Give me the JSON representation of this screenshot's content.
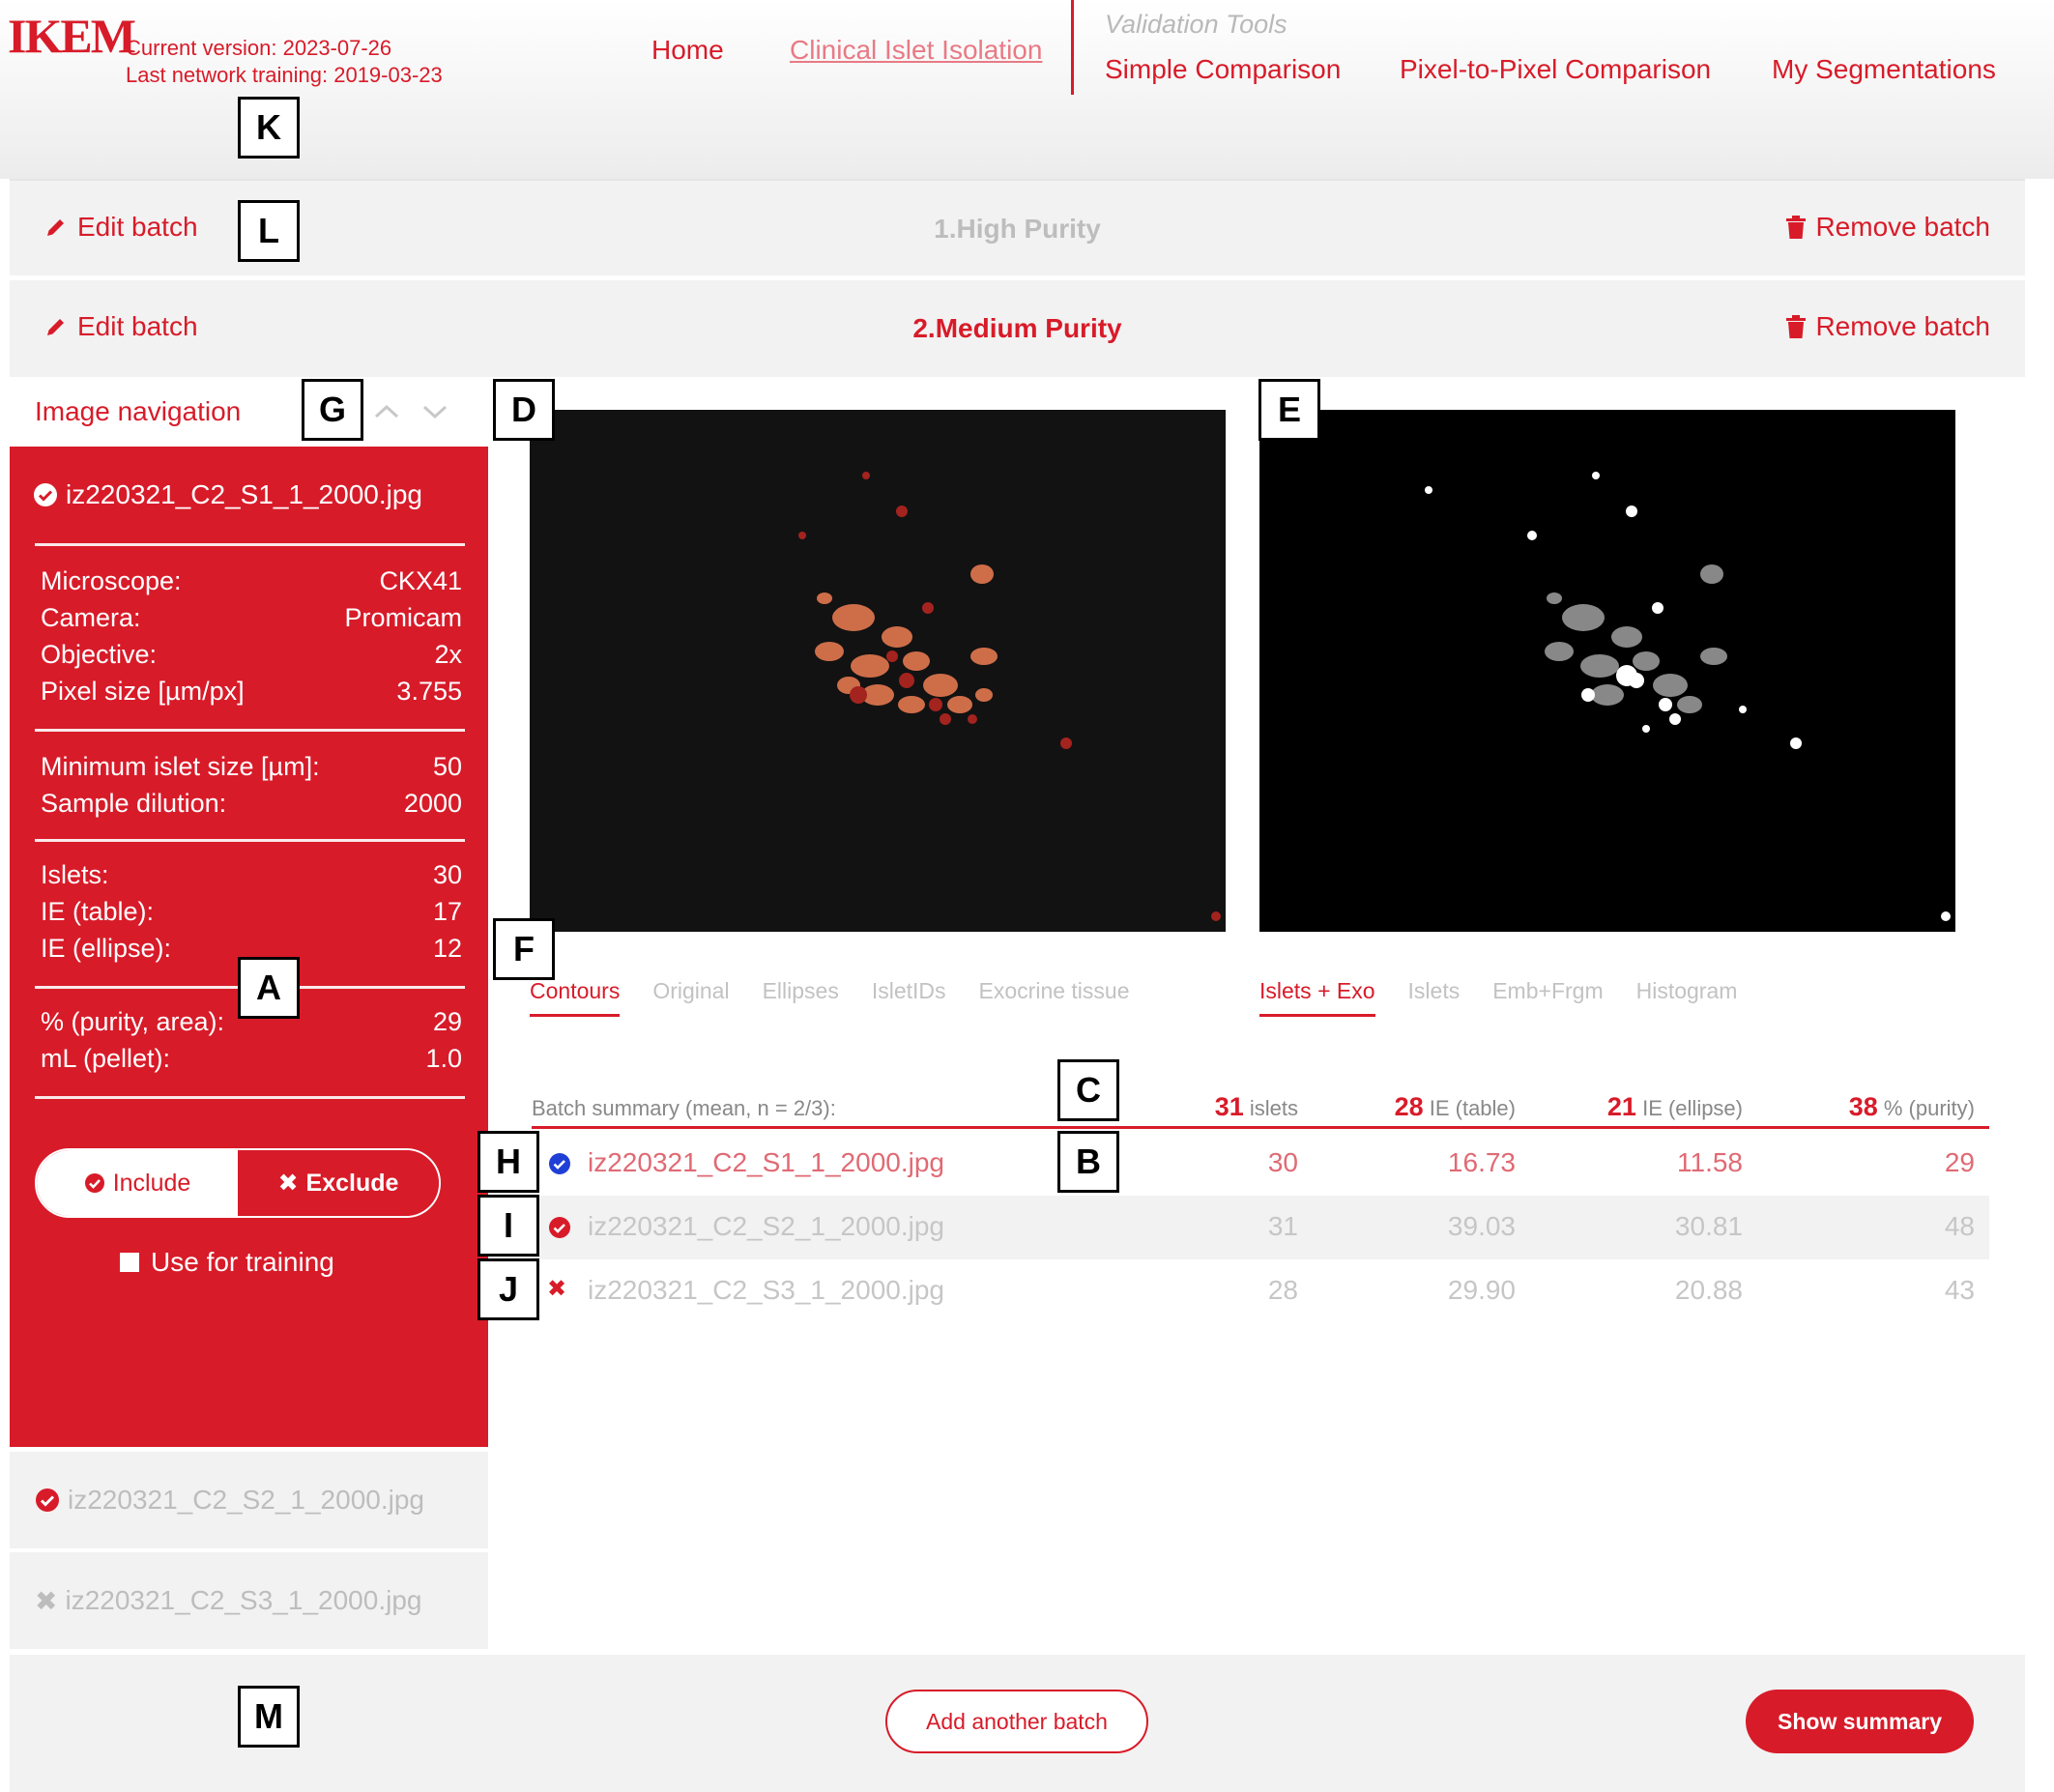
{
  "header": {
    "logo_line1": "IKEM",
    "logo_line2": "M",
    "current_version": "Current version: 2023-07-26",
    "last_training": "Last network training: 2019-03-23",
    "nav": {
      "home": "Home",
      "clinical": "Clinical Islet Isolation",
      "group_label": "Validation Tools",
      "simple": "Simple Comparison",
      "pixel": "Pixel-to-Pixel Comparison",
      "my_segmentations": "My Segmentations"
    }
  },
  "batches": [
    {
      "title": "1.High Purity",
      "edit_label": "Edit batch",
      "remove_label": "Remove batch"
    },
    {
      "title": "2.Medium Purity",
      "edit_label": "Edit batch",
      "remove_label": "Remove batch"
    }
  ],
  "sidebar": {
    "nav_label": "Image navigation",
    "selected_file": "iz220321_C2_S1_1_2000.jpg",
    "microscope_label": "Microscope:",
    "microscope": "CKX41",
    "camera_label": "Camera:",
    "camera": "Promicam",
    "objective_label": "Objective:",
    "objective": "2x",
    "pixel_label": "Pixel size [µm/px]",
    "pixel_size": "3.755",
    "min_islet_label": "Minimum islet size [µm]:",
    "min_islet": "50",
    "dilution_label": "Sample dilution:",
    "dilution": "2000",
    "islets_label": "Islets:",
    "islets": "30",
    "ie_table_label": "IE (table):",
    "ie_table": "17",
    "ie_ellipse_label": "IE (ellipse):",
    "ie_ellipse": "12",
    "purity_label": "% (purity, area):",
    "purity": "29",
    "pellet_label": "mL (pellet):",
    "pellet": "1.0",
    "include_label": "Include",
    "exclude_label": "Exclude",
    "training_label": "Use for training",
    "other_files": [
      "iz220321_C2_S2_1_2000.jpg",
      "iz220321_C2_S3_1_2000.jpg"
    ]
  },
  "tabs_left": [
    "Contours",
    "Original",
    "Ellipses",
    "IsletIDs",
    "Exocrine tissue"
  ],
  "tabs_right": [
    "Islets + Exo",
    "Islets",
    "Emb+Frgm",
    "Histogram"
  ],
  "summary": {
    "label": "Batch summary (mean, n = 2/3):",
    "islets_val": "31",
    "islets_unit": "islets",
    "ie_table_val": "28",
    "ie_table_unit": "IE (table)",
    "ie_ellipse_val": "21",
    "ie_ellipse_unit": "IE (ellipse)",
    "purity_val": "38",
    "purity_unit": "% (purity)",
    "rows": [
      {
        "file": "iz220321_C2_S1_1_2000.jpg",
        "islets": "30",
        "ie_table": "16.73",
        "ie_ellipse": "11.58",
        "purity": "29",
        "status": "current"
      },
      {
        "file": "iz220321_C2_S2_1_2000.jpg",
        "islets": "31",
        "ie_table": "39.03",
        "ie_ellipse": "30.81",
        "purity": "48",
        "status": "included"
      },
      {
        "file": "iz220321_C2_S3_1_2000.jpg",
        "islets": "28",
        "ie_table": "29.90",
        "ie_ellipse": "20.88",
        "purity": "43",
        "status": "excluded"
      }
    ]
  },
  "footer": {
    "add_batch": "Add another batch",
    "show_summary": "Show summary"
  },
  "markers": [
    "A",
    "B",
    "C",
    "D",
    "E",
    "F",
    "G",
    "H",
    "I",
    "J",
    "K",
    "L",
    "M"
  ],
  "colors": {
    "accent": "#d81b29",
    "panel_bg": "#f2f2f2",
    "current_indicator": "#1f3fd6"
  }
}
